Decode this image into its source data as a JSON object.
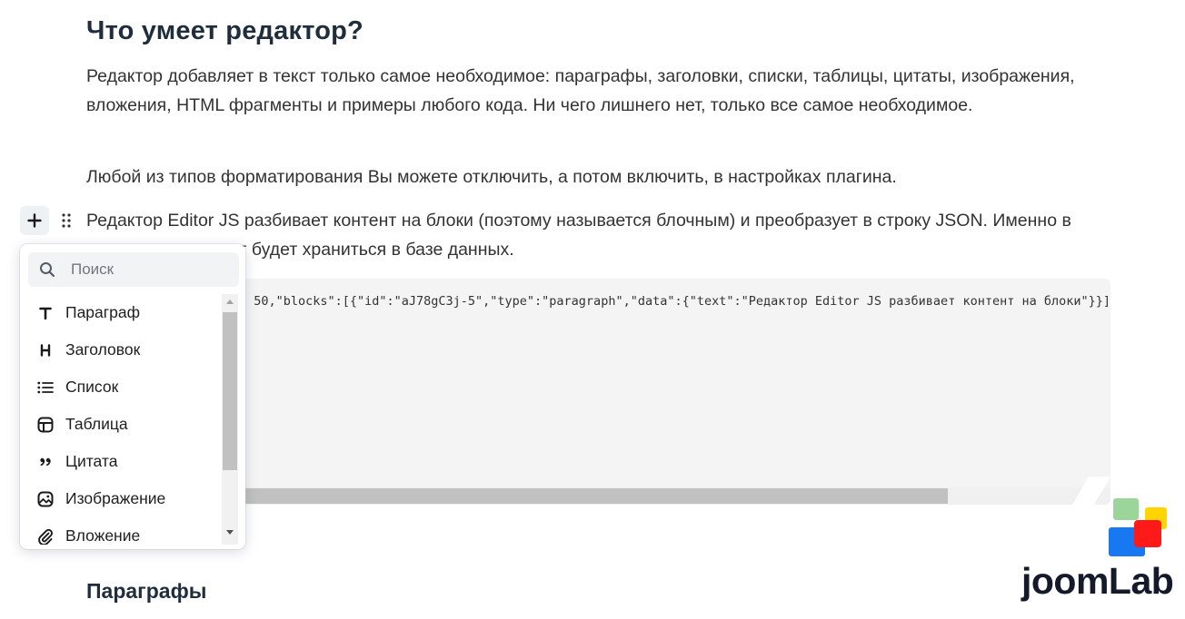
{
  "article": {
    "heading": "Что умеет редактор?",
    "paragraph_1": "Редактор добавляет в текст только самое необходимое: параграфы, заголовки, списки, таблицы, цитаты, изображения, вложения, HTML фрагменты и примеры любого кода. Ни чего лишнего нет, только все самое необходимое.",
    "paragraph_2": "Любой из типов форматирования Вы можете отключить, а потом включить, в настройках плагина.",
    "paragraph_3": "Редактор Editor JS разбивает контент на блоки (поэтому называется блочным) и преобразует в строку JSON. Именно в таком виде контент будет храниться в базе данных.",
    "code_visible": "50,\"blocks\":[{\"id\":\"aJ78gC3j-5\",\"type\":\"paragraph\",\"data\":{\"text\":\"Редактор Editor JS разбивает контент на блоки\"}}]",
    "subheading": "Параграфы"
  },
  "block_actions": {
    "plus_icon": "plus-icon",
    "drag_icon": "drag-handle-icon"
  },
  "toolbox": {
    "search_placeholder": "Поиск",
    "search_icon": "search-icon",
    "items": [
      {
        "label": "Параграф",
        "icon": "paragraph-T-icon"
      },
      {
        "label": "Заголовок",
        "icon": "heading-H-icon"
      },
      {
        "label": "Список",
        "icon": "list-icon"
      },
      {
        "label": "Таблица",
        "icon": "table-icon"
      },
      {
        "label": "Цитата",
        "icon": "quote-icon"
      },
      {
        "label": "Изображение",
        "icon": "image-icon"
      },
      {
        "label": "Вложение",
        "icon": "attachment-icon"
      }
    ]
  },
  "brand": {
    "name": "joomLab",
    "colors": {
      "green": "#9bd59a",
      "yellow": "#ffd500",
      "blue": "#1778f2",
      "red": "#ff1a1a"
    }
  }
}
